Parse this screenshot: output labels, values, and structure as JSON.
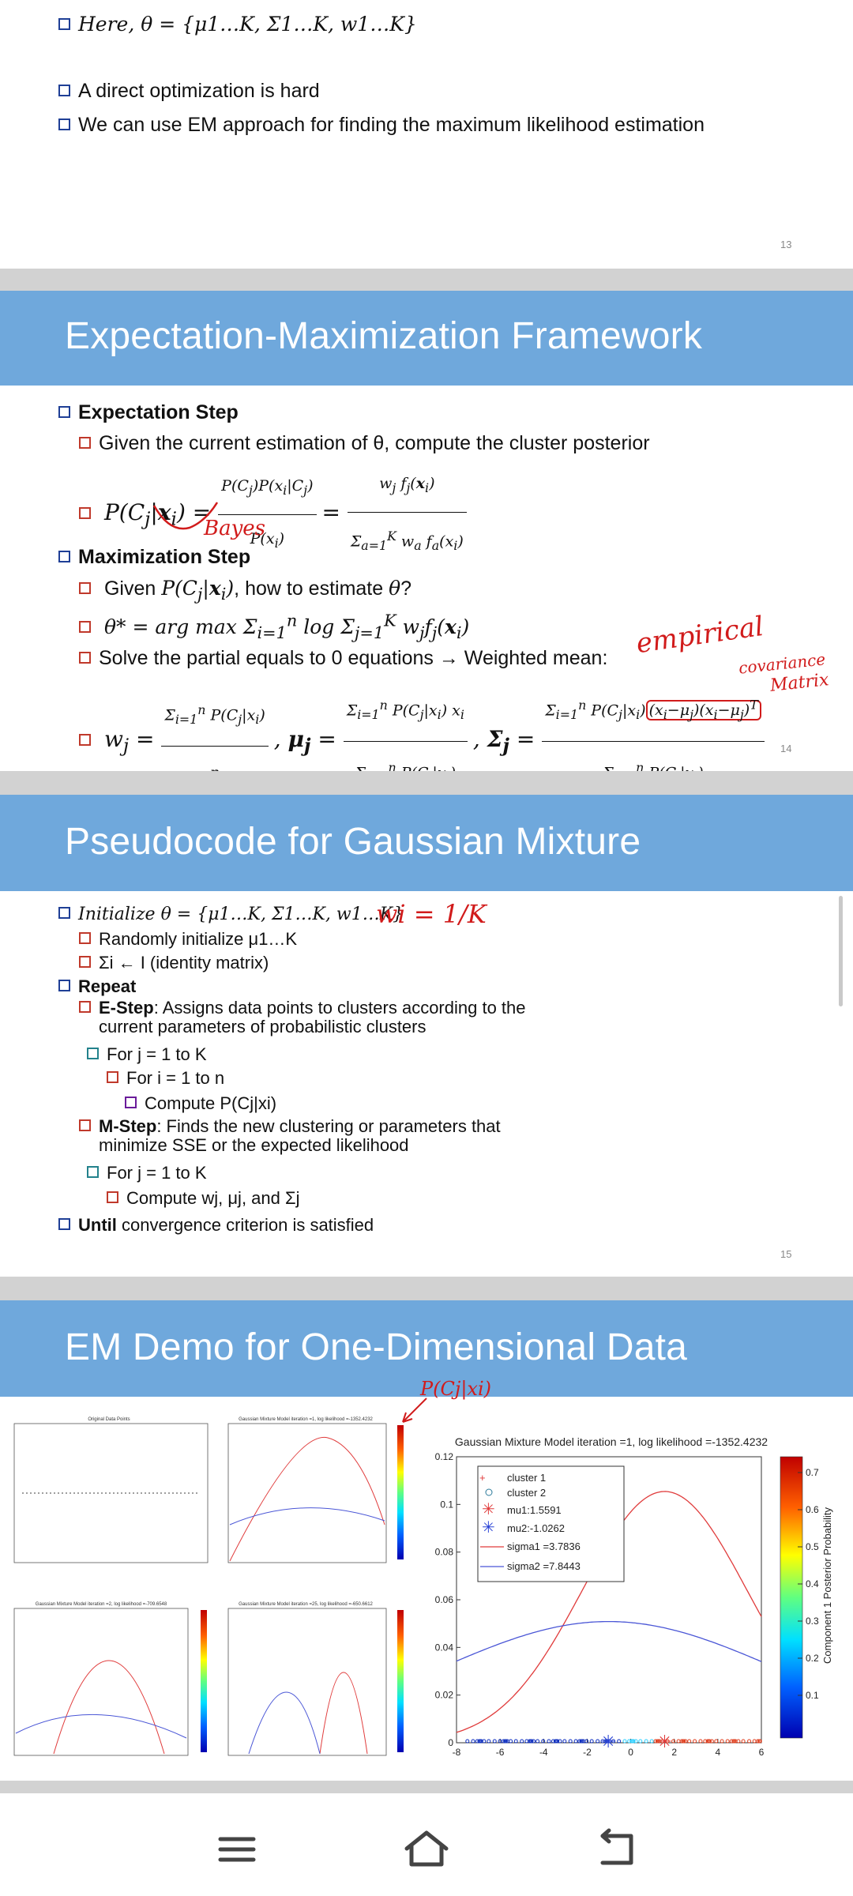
{
  "slide13": {
    "line1": "Here, θ = {μ1…K, Σ1…K, w1…K}",
    "line2": "A direct optimization is hard",
    "line3": "We can use EM approach for finding the maximum likelihood estimation",
    "page": "13"
  },
  "slide14": {
    "title": "Expectation-Maximization Framework",
    "exp_step": "Expectation Step",
    "exp_desc": "Given the current estimation of θ, compute the cluster posterior",
    "max_step": "Maximization Step",
    "max_q": "Given P(Cj|xi), how to estimate θ?",
    "max_eq": "θ* = arg max Σ log Σ wj fj(xi)",
    "solve": "Solve the partial equals to 0 equations → Weighted mean:",
    "ink_bayes": "Bayes",
    "ink_empirical": "empirical",
    "ink_covariance": "covariance",
    "ink_matrix": "Matrix",
    "page": "14"
  },
  "slide15": {
    "title": "Pseudocode for Gaussian Mixture",
    "l1": "Initialize θ = {μ1…K, Σ1…K, w1…K}",
    "l2": "Randomly initialize μ1…K",
    "l3": "Σi ← I (identity matrix)",
    "l4": "Repeat",
    "l5a": "E-Step",
    "l5b": ": Assigns data points to clusters according to the",
    "l5c": "current parameters of probabilistic clusters",
    "l6": "For j = 1 to K",
    "l7": "For i = 1 to n",
    "l8": "Compute P(Cj|xi)",
    "l9a": "M-Step",
    "l9b": ": Finds the new clustering or parameters that",
    "l9c": "minimize SSE or the expected likelihood",
    "l10": "For j = 1 to K",
    "l11": "Compute wj, μj, and Σj",
    "l12a": "Until",
    "l12b": " convergence criterion is satisfied",
    "ink_w": "wi = 1/K",
    "page": "15"
  },
  "slide16": {
    "title": "EM Demo for One-Dimensional Data",
    "ink_p": "P(Cj|xi)",
    "small_titles": {
      "orig": "Original Data Points",
      "it1": "Gaussian Mixture Model iteration =1, log likelihood =-1352.4232",
      "it2": "Gaussian Mixture Model iteration =2, log likelihood =-709.6548",
      "it25": "Gaussian Mixture Model iteration =25, log likelihood =-650.6612"
    },
    "big": {
      "title": "Gaussian Mixture Model iteration =1, log likelihood =-1352.4232",
      "legend": [
        "cluster 1",
        "cluster 2",
        "mu1:1.5591",
        "mu2:-1.0262",
        "sigma1 =3.7836",
        "sigma2 =7.8443"
      ],
      "colorbar_label": "Component 1 Posterior Probability",
      "colorbar_ticks": [
        "0.7",
        "0.6",
        "0.5",
        "0.4",
        "0.3",
        "0.2",
        "0.1"
      ]
    }
  },
  "chart_data": {
    "type": "line",
    "title": "Gaussian Mixture Model iteration =1, log likelihood =-1352.4232",
    "xlabel": "",
    "ylabel": "",
    "xlim": [
      -8,
      6
    ],
    "ylim": [
      0,
      0.12
    ],
    "x_ticks": [
      "-8",
      "-6",
      "-4",
      "-2",
      "0",
      "2",
      "4",
      "6"
    ],
    "y_ticks": [
      "0",
      "0.02",
      "0.04",
      "0.06",
      "0.08",
      "0.1",
      "0.12"
    ],
    "series": [
      {
        "name": "sigma1 =3.7836",
        "color": "#e03b3b",
        "mu": 1.5591,
        "sigma": 3.7836,
        "weight": 1.0
      },
      {
        "name": "sigma2 =7.8443",
        "color": "#4a56d6",
        "mu": -1.0262,
        "sigma": 7.8443,
        "weight": 1.0
      }
    ],
    "markers": [
      {
        "name": "mu1:1.5591",
        "x": 1.5591,
        "color": "#e03b3b"
      },
      {
        "name": "mu2:-1.0262",
        "x": -1.0262,
        "color": "#2b44d6"
      }
    ]
  },
  "nav": {
    "menu": "menu-icon",
    "home": "home-icon",
    "back": "back-icon"
  },
  "colors": {
    "title_band": "#6fa8dc",
    "bullet": "#1f3f96",
    "ink": "#d11b1b"
  }
}
